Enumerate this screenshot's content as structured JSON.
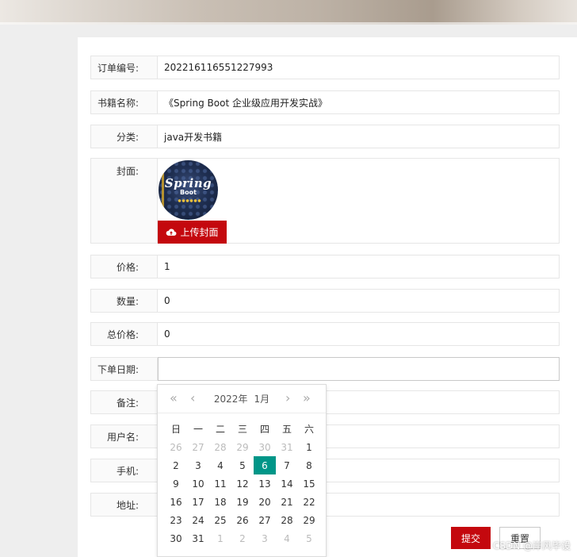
{
  "form": {
    "order_no": {
      "label": "订单编号:",
      "value": "202216116551227993"
    },
    "book_name": {
      "label": "书籍名称:",
      "value": "《Spring Boot 企业级应用开发实战》"
    },
    "category": {
      "label": "分类:",
      "value": "java开发书籍"
    },
    "cover": {
      "label": "封面:",
      "upload_label": "上传封面",
      "image_title": "Spring",
      "image_subtitle": "Boot"
    },
    "price": {
      "label": "价格:",
      "value": "1"
    },
    "quantity": {
      "label": "数量:",
      "value": "0"
    },
    "total": {
      "label": "总价格:",
      "value": "0"
    },
    "order_date": {
      "label": "下单日期:",
      "value": ""
    },
    "note": {
      "label": "备注:",
      "value": ""
    },
    "username": {
      "label": "用户名:",
      "value": ""
    },
    "phone": {
      "label": "手机:",
      "value": ""
    },
    "address": {
      "label": "地址:",
      "value": ""
    }
  },
  "calendar": {
    "year": "2022年",
    "month": "1月",
    "prev_year_icon": "double-chevron-left",
    "prev_month_icon": "chevron-left",
    "next_month_icon": "chevron-right",
    "next_year_icon": "double-chevron-right",
    "weekdays": [
      "日",
      "一",
      "二",
      "三",
      "四",
      "五",
      "六"
    ],
    "days": [
      {
        "d": "26",
        "t": "other"
      },
      {
        "d": "27",
        "t": "other"
      },
      {
        "d": "28",
        "t": "other"
      },
      {
        "d": "29",
        "t": "other"
      },
      {
        "d": "30",
        "t": "other"
      },
      {
        "d": "31",
        "t": "other"
      },
      {
        "d": "1",
        "t": "cur"
      },
      {
        "d": "2",
        "t": "cur"
      },
      {
        "d": "3",
        "t": "cur"
      },
      {
        "d": "4",
        "t": "cur"
      },
      {
        "d": "5",
        "t": "cur"
      },
      {
        "d": "6",
        "t": "sel"
      },
      {
        "d": "7",
        "t": "cur"
      },
      {
        "d": "8",
        "t": "cur"
      },
      {
        "d": "9",
        "t": "cur"
      },
      {
        "d": "10",
        "t": "cur"
      },
      {
        "d": "11",
        "t": "cur"
      },
      {
        "d": "12",
        "t": "cur"
      },
      {
        "d": "13",
        "t": "cur"
      },
      {
        "d": "14",
        "t": "cur"
      },
      {
        "d": "15",
        "t": "cur"
      },
      {
        "d": "16",
        "t": "cur"
      },
      {
        "d": "17",
        "t": "cur"
      },
      {
        "d": "18",
        "t": "cur"
      },
      {
        "d": "19",
        "t": "cur"
      },
      {
        "d": "20",
        "t": "cur"
      },
      {
        "d": "21",
        "t": "cur"
      },
      {
        "d": "22",
        "t": "cur"
      },
      {
        "d": "23",
        "t": "cur"
      },
      {
        "d": "24",
        "t": "cur"
      },
      {
        "d": "25",
        "t": "cur"
      },
      {
        "d": "26",
        "t": "cur"
      },
      {
        "d": "27",
        "t": "cur"
      },
      {
        "d": "28",
        "t": "cur"
      },
      {
        "d": "29",
        "t": "cur"
      },
      {
        "d": "30",
        "t": "cur"
      },
      {
        "d": "31",
        "t": "cur"
      },
      {
        "d": "1",
        "t": "other"
      },
      {
        "d": "2",
        "t": "other"
      },
      {
        "d": "3",
        "t": "other"
      },
      {
        "d": "4",
        "t": "other"
      },
      {
        "d": "5",
        "t": "other"
      }
    ]
  },
  "buttons": {
    "submit": "提交",
    "reset": "重置"
  },
  "watermark": "CSDN @岸风毕设",
  "colors": {
    "primary_red": "#c4080e",
    "selected_day": "#009688"
  }
}
